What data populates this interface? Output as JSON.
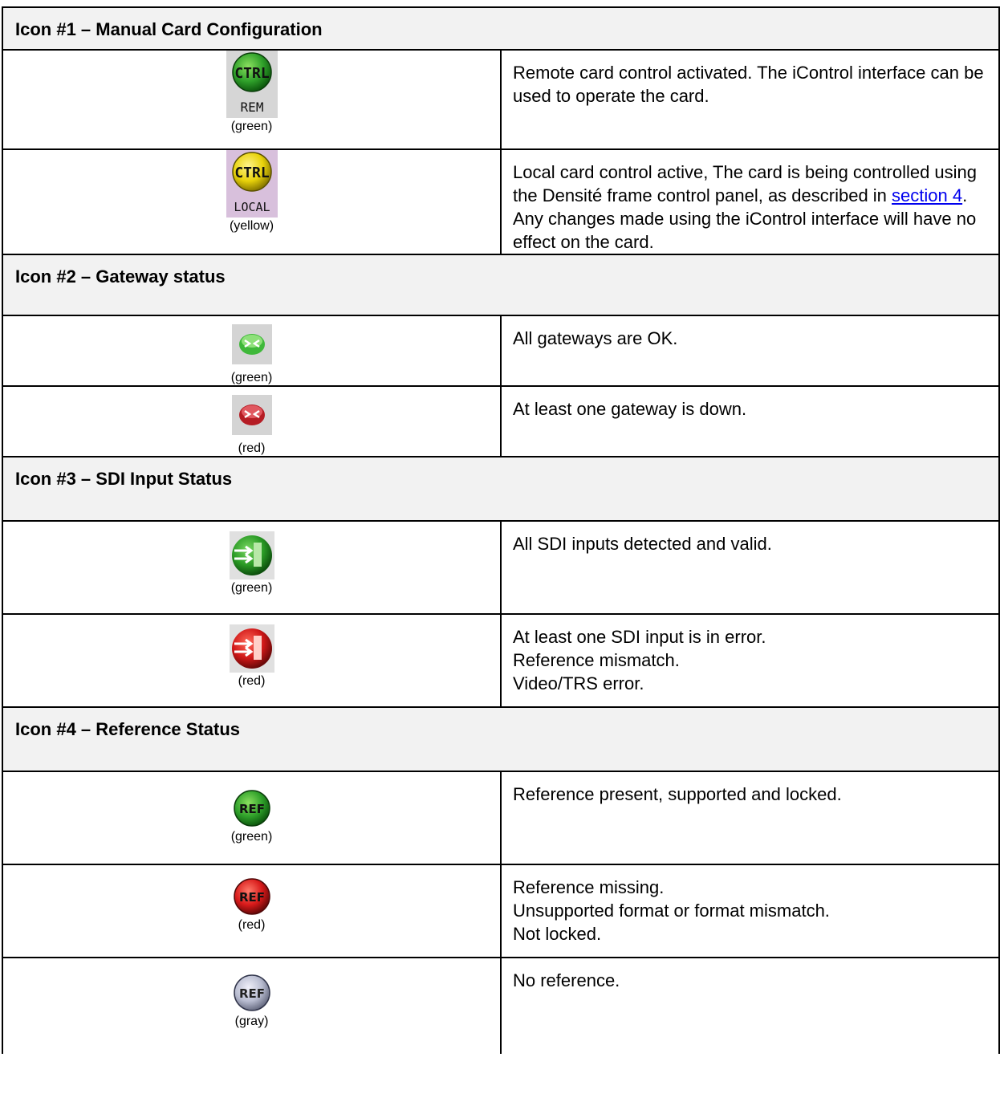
{
  "sections": [
    {
      "title": "Icon #1 – Manual Card Configuration",
      "rows": [
        {
          "icon": "ctrl-rem-icon",
          "icon_text": "CTRL",
          "icon_label": "REM",
          "caption": "(green)",
          "lines": [
            "Remote card control activated. The iControl interface can be used to operate the card."
          ]
        },
        {
          "icon": "ctrl-local-icon",
          "icon_text": "CTRL",
          "icon_label": "LOCAL",
          "caption": "(yellow)",
          "desc_before": "Local card control active, The card is being controlled using the Densité frame control panel, as described in ",
          "link": "section 4",
          "desc_after": ". Any changes made using the iControl interface will have no effect on the card."
        }
      ]
    },
    {
      "title": "Icon #2 – Gateway status",
      "rows": [
        {
          "icon": "gateway-ok-icon",
          "caption": "(green)",
          "lines": [
            "All gateways are OK."
          ]
        },
        {
          "icon": "gateway-down-icon",
          "caption": "(red)",
          "lines": [
            "At least one gateway is down."
          ]
        }
      ]
    },
    {
      "title": "Icon #3 – SDI Input Status",
      "rows": [
        {
          "icon": "sdi-input-ok-icon",
          "caption": "(green)",
          "lines": [
            "All SDI inputs detected and valid."
          ]
        },
        {
          "icon": "sdi-input-error-icon",
          "caption": "(red)",
          "lines": [
            "At least one SDI input is in error.",
            "Reference mismatch.",
            "Video/TRS error."
          ]
        }
      ]
    },
    {
      "title": "Icon #4 – Reference Status",
      "rows": [
        {
          "icon": "ref-ok-icon",
          "icon_text": "REF",
          "caption": "(green)",
          "lines": [
            "Reference present, supported and locked."
          ]
        },
        {
          "icon": "ref-missing-icon",
          "icon_text": "REF",
          "caption": "(red)",
          "lines": [
            "Reference missing.",
            "Unsupported format or format mismatch.",
            "Not locked."
          ]
        },
        {
          "icon": "ref-none-icon",
          "icon_text": "REF",
          "caption": "(gray)",
          "lines": [
            "No reference."
          ]
        }
      ]
    }
  ],
  "colors": {
    "green": "#2fa02a",
    "yellow": "#e8d20a",
    "red": "#c81818",
    "gray": "#b8bcd0",
    "header_bg": "#f2f2f2",
    "link": "#0000ee"
  }
}
